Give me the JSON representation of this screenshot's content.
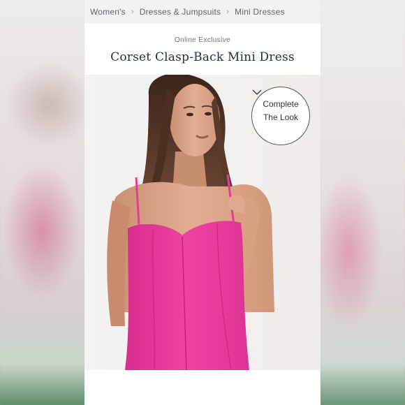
{
  "breadcrumb": {
    "items": [
      "Women's",
      "Dresses & Jumpsuits",
      "Mini Dresses"
    ],
    "separator": "›"
  },
  "product": {
    "eyebrow": "Online Exclusive",
    "title": "Corset Clasp-Back Mini Dress",
    "dress_color": "#ee3fa0"
  },
  "complete_the_look": {
    "line1": "Complete",
    "line2": "The Look",
    "icon": "chevron-down-icon"
  }
}
